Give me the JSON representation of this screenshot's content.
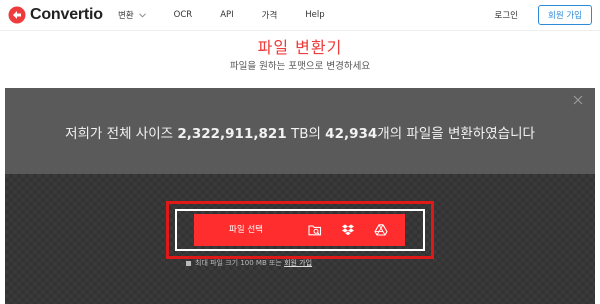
{
  "brand": {
    "name": "Convertio",
    "accent": "#ee3b3b"
  },
  "nav": {
    "items": [
      {
        "label": "변환",
        "has_dropdown": true
      },
      {
        "label": "OCR"
      },
      {
        "label": "API"
      },
      {
        "label": "가격"
      },
      {
        "label": "Help"
      }
    ],
    "login_label": "로그인",
    "signup_label": "회원 가입"
  },
  "hero": {
    "title": "파일 변환기",
    "subtitle": "파일을 원하는 포맷으로 변경하세요"
  },
  "panel": {
    "stats": {
      "prefix": "저희가 전체 사이즈 ",
      "size": "2,322,911,821",
      "size_unit": " TB의 ",
      "count": "42,934",
      "suffix": "개의 파일을 변환하였습니다"
    },
    "choose_button": {
      "label": "파일 선택",
      "icons": [
        "folder-search-icon",
        "dropbox-icon",
        "google-drive-icon"
      ]
    },
    "note": {
      "text": "최대 파일 크기 100 MB 또는 ",
      "link": "회원 가입"
    }
  }
}
